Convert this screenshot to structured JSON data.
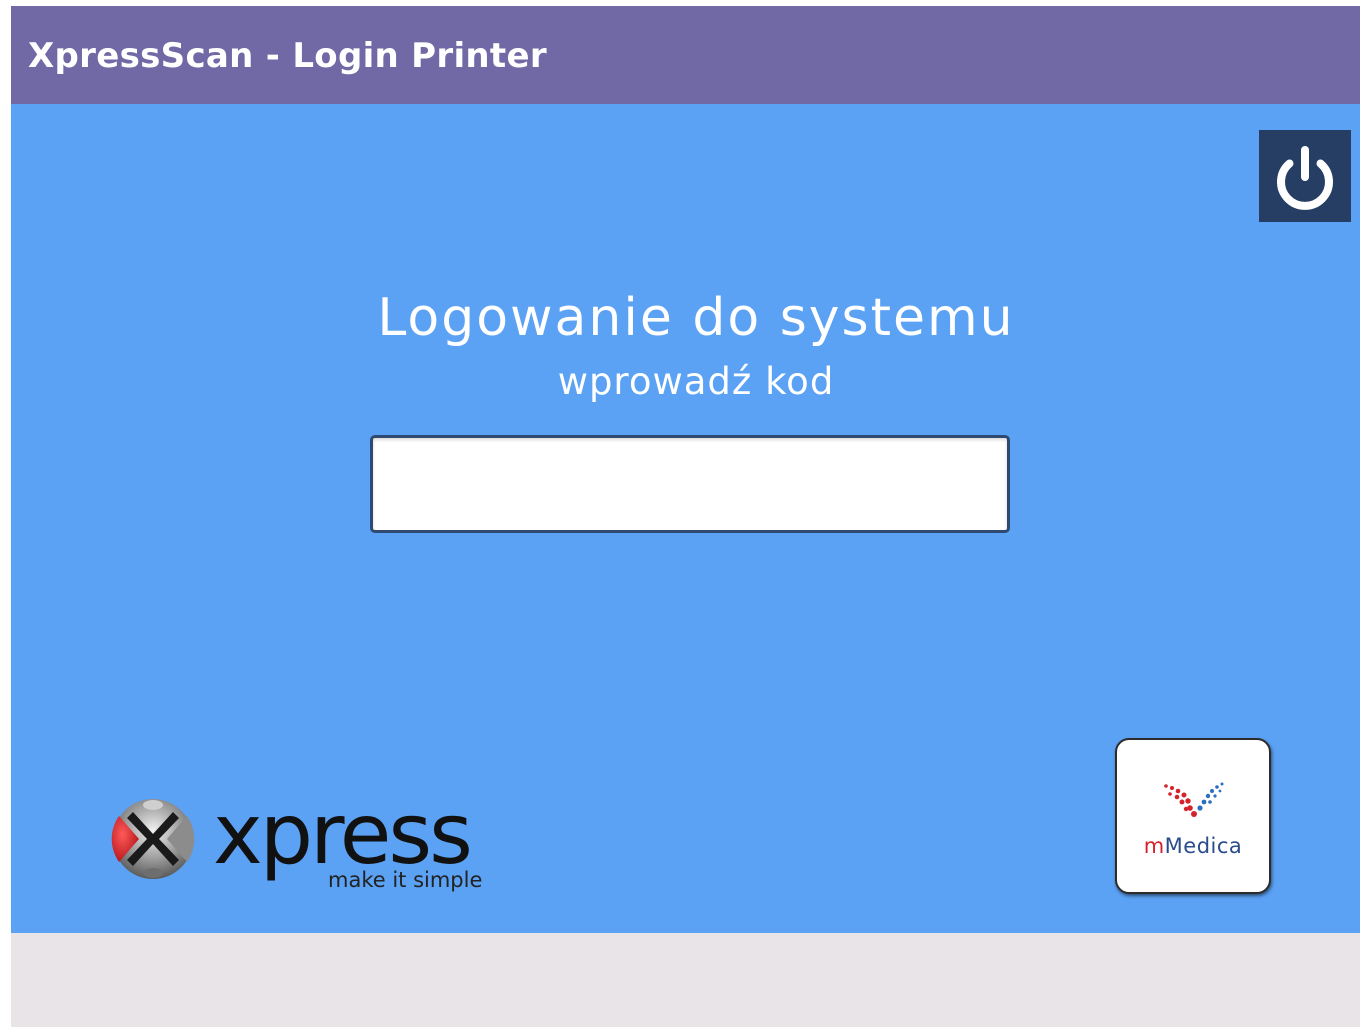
{
  "window": {
    "title": "XpressScan - Login Printer"
  },
  "login": {
    "heading": "Logowanie do systemu",
    "subheading": "wprowadź kod",
    "code_value": "",
    "code_placeholder": ""
  },
  "logos": {
    "xpress": {
      "word": "xpress",
      "tagline": "make it simple"
    },
    "mmedica": {
      "prefix": "m",
      "word": "Medica"
    }
  },
  "colors": {
    "titlebar": "#7169a5",
    "background": "#5ba1f4",
    "power_button": "#263e63",
    "footer": "#e8e4e8",
    "mmedica_red": "#d4232b",
    "mmedica_blue": "#2a4c8c"
  },
  "icons": {
    "power": "power-icon"
  }
}
